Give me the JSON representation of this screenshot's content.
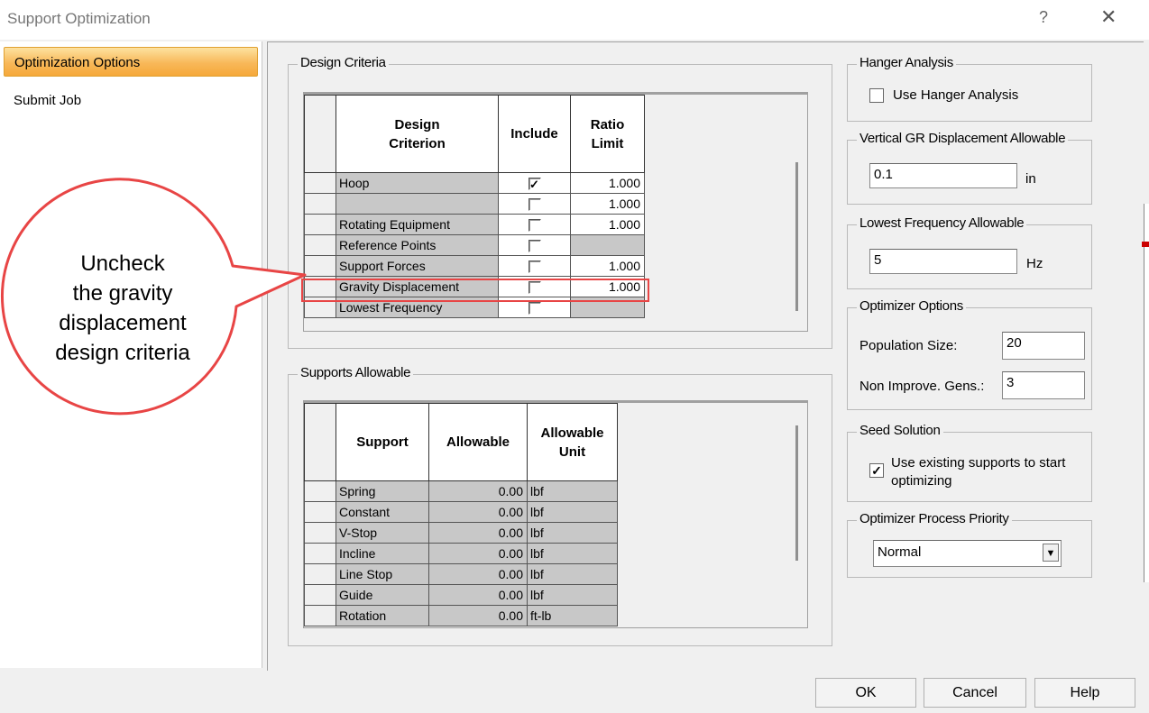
{
  "window": {
    "title": "Support Optimization",
    "help_glyph": "?",
    "close_glyph": "✕"
  },
  "nav": {
    "items": [
      {
        "label": "Optimization Options",
        "selected": true
      },
      {
        "label": "Submit Job",
        "selected": false
      }
    ]
  },
  "design_criteria": {
    "title": "Design Criteria",
    "headers": [
      "Design Criterion",
      "Include",
      "Ratio Limit"
    ],
    "rows": [
      {
        "name": "Hoop",
        "include": true,
        "ratio": "1.000"
      },
      {
        "name": "",
        "include": false,
        "ratio": "1.000"
      },
      {
        "name": "Rotating Equipment",
        "include": false,
        "ratio": "1.000"
      },
      {
        "name": "Reference Points",
        "include": false,
        "ratio": ""
      },
      {
        "name": "Support Forces",
        "include": false,
        "ratio": "1.000"
      },
      {
        "name": "Gravity Displacement",
        "include": false,
        "ratio": "1.000"
      },
      {
        "name": "Lowest Frequency",
        "include": false,
        "ratio": ""
      }
    ]
  },
  "supports_allowable": {
    "title": "Supports Allowable",
    "headers": [
      "Support",
      "Allowable",
      "Allowable Unit"
    ],
    "rows": [
      {
        "support": "Spring",
        "allowable": "0.00",
        "unit": "lbf"
      },
      {
        "support": "Constant",
        "allowable": "0.00",
        "unit": "lbf"
      },
      {
        "support": "V-Stop",
        "allowable": "0.00",
        "unit": "lbf"
      },
      {
        "support": "Incline",
        "allowable": "0.00",
        "unit": "lbf"
      },
      {
        "support": "Line Stop",
        "allowable": "0.00",
        "unit": "lbf"
      },
      {
        "support": "Guide",
        "allowable": "0.00",
        "unit": "lbf"
      },
      {
        "support": "Rotation",
        "allowable": "0.00",
        "unit": "ft-lb"
      }
    ]
  },
  "hanger": {
    "title": "Hanger Analysis",
    "checkbox_label": "Use Hanger Analysis",
    "checked": false
  },
  "vertical_gr": {
    "title": "Vertical GR Displacement Allowable",
    "value": "0.1",
    "unit": "in"
  },
  "lowest_freq": {
    "title": "Lowest Frequency Allowable",
    "value": "5",
    "unit": "Hz"
  },
  "optimizer_options": {
    "title": "Optimizer Options",
    "population_label": "Population Size:",
    "population_value": "20",
    "nonimprove_label": "Non Improve. Gens.:",
    "nonimprove_value": "3"
  },
  "seed": {
    "title": "Seed Solution",
    "label_line1": "Use existing supports to start",
    "label_line2": "optimizing",
    "checked": true
  },
  "priority": {
    "title": "Optimizer Process Priority",
    "value": "Normal"
  },
  "buttons": {
    "ok": "OK",
    "cancel": "Cancel",
    "help": "Help"
  },
  "callout": {
    "line1": "Uncheck",
    "line2": "the gravity",
    "line3": "displacement",
    "line4": "design criteria",
    "stroke": "#e84545"
  }
}
